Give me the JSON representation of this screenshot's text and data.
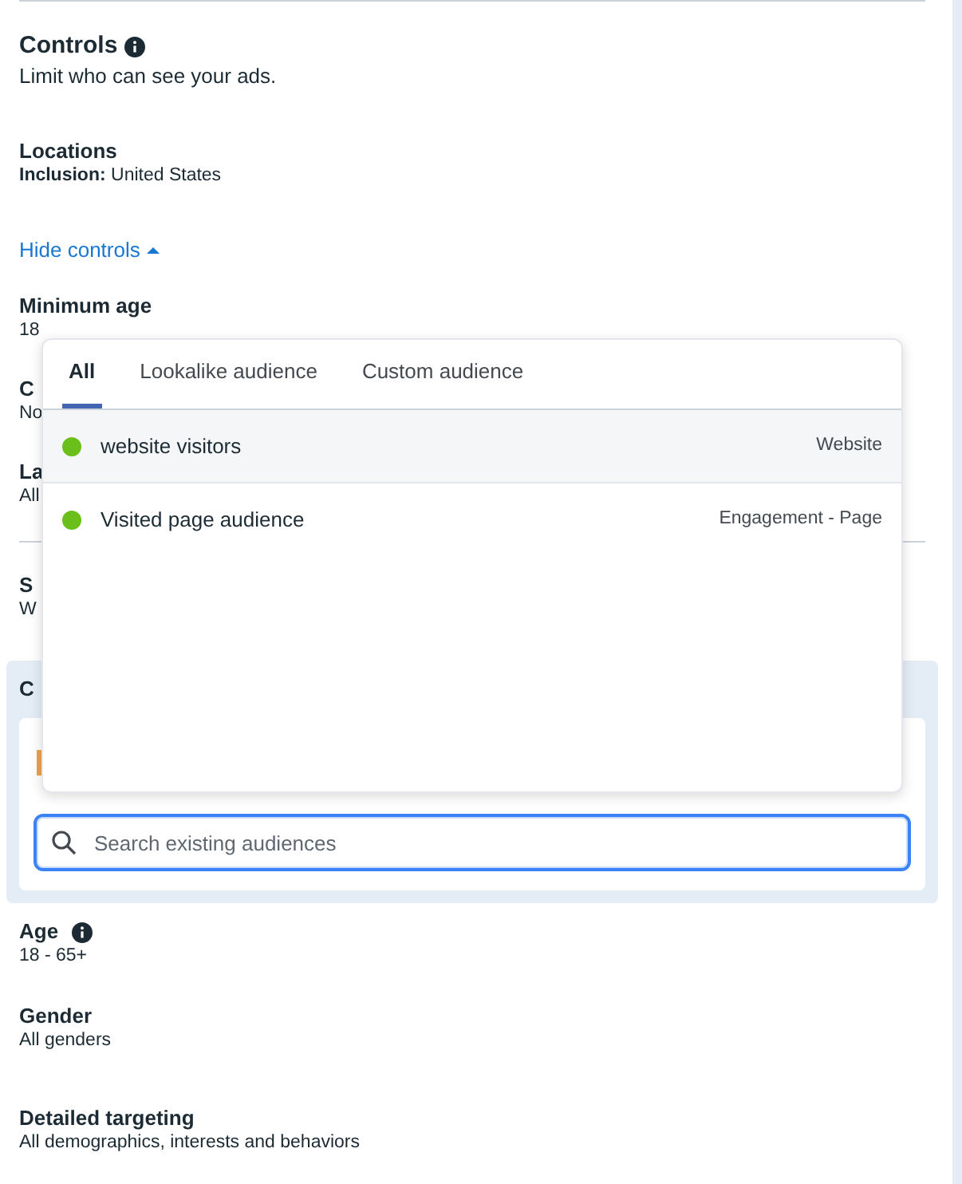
{
  "controls": {
    "title": "Controls",
    "subtitle": "Limit who can see your ads."
  },
  "locations": {
    "label": "Locations",
    "value_label": "Inclusion:",
    "value": "United States"
  },
  "toggle": {
    "label": "Hide controls",
    "expanded": true
  },
  "minimum_age": {
    "label": "Minimum age",
    "value": "18"
  },
  "partial_rows": [
    {
      "label": "C",
      "value": "No"
    },
    {
      "label": "La",
      "value": "All"
    }
  ],
  "section_partial": {
    "label": "S",
    "value": "W"
  },
  "custom_audience_panel": {
    "label": "C"
  },
  "dropdown": {
    "tabs": [
      {
        "label": "All",
        "selected": true
      },
      {
        "label": "Lookalike audience",
        "selected": false
      },
      {
        "label": "Custom audience",
        "selected": false
      }
    ],
    "items": [
      {
        "name": "website visitors",
        "source": "Website",
        "color": "#6bbf1a",
        "highlighted": true
      },
      {
        "name": "Visited page audience",
        "source": "Engagement - Page",
        "color": "#6bbf1a",
        "highlighted": false
      }
    ]
  },
  "search": {
    "placeholder": "Search existing audiences"
  },
  "summary": [
    {
      "label": "Age",
      "info": true,
      "value": "18 - 65+"
    },
    {
      "label": "Gender",
      "value": "All genders"
    },
    {
      "label": "Detailed targeting",
      "value": "All demographics, interests and behaviors"
    }
  ]
}
